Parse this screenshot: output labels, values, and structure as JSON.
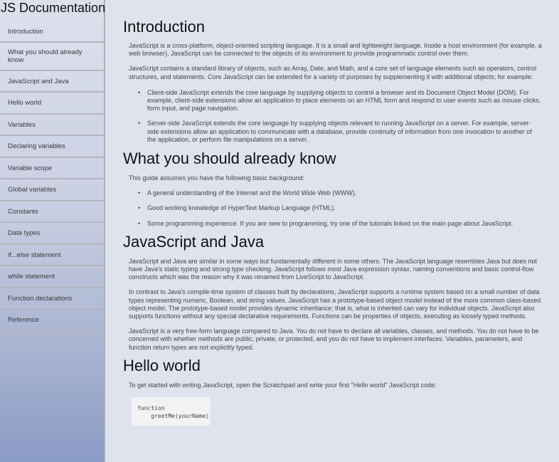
{
  "navbar": {
    "title": "JS Documentation",
    "items": [
      {
        "label": "Introduction"
      },
      {
        "label": "What you should already know"
      },
      {
        "label": "JavaScript and Java"
      },
      {
        "label": "Hello world"
      },
      {
        "label": "Variables"
      },
      {
        "label": "Declaring variables"
      },
      {
        "label": "Variable scope"
      },
      {
        "label": "Global variables"
      },
      {
        "label": "Constants"
      },
      {
        "label": "Data types"
      },
      {
        "label": "if...else statement"
      },
      {
        "label": "while statement"
      },
      {
        "label": "Function declarations"
      },
      {
        "label": "Reference"
      }
    ]
  },
  "sections": {
    "introduction": {
      "title": "Introduction",
      "p1": "JavaScript is a cross-platform, object-oriented scripting language. It is a small and lightweight language. Inside a host environment (for example, a web browser), JavaScript can be connected to the objects of its environment to provide programmatic control over them.",
      "p2": "JavaScript contains a standard library of objects, such as Array, Date, and Math, and a core set of language elements such as operators, control structures, and statements. Core JavaScript can be extended for a variety of purposes by supplementing it with additional objects; for example:",
      "li1": "Client-side JavaScript extends the core language by supplying objects to control a browser and its Document Object Model (DOM). For example, client-side extensions allow an application to place elements on an HTML form and respond to user events such as mouse clicks, form input, and page navigation.",
      "li2": "Server-side JavaScript extends the core language by supplying objects relevant to running JavaScript on a server. For example, server-side extensions allow an application to communicate with a database, provide continuity of information from one invocation to another of the application, or perform file manipulations on a server."
    },
    "what_you_should_know": {
      "title": "What you should already know",
      "p1": "This guide assumes you have the following basic background:",
      "li1": "A general understanding of the Internet and the World Wide Web (WWW).",
      "li2": "Good working knowledge of HyperText Markup Language (HTML).",
      "li3": "Some programming experience. If you are new to programming, try one of the tutorials linked on the main page about JavaScript."
    },
    "javascript_and_java": {
      "title": "JavaScript and Java",
      "p1": "JavaScript and Java are similar in some ways but fundamentally different in some others. The JavaScript language resembles Java but does not have Java's static typing and strong type checking. JavaScript follows most Java expression syntax, naming conventions and basic control-flow constructs which was the reason why it was renamed from LiveScript to JavaScript.",
      "p2": "In contrast to Java's compile-time system of classes built by declarations, JavaScript supports a runtime system based on a small number of data types representing numeric, Boolean, and string values. JavaScript has a prototype-based object model instead of the more common class-based object model. The prototype-based model provides dynamic inheritance; that is, what is inherited can vary for individual objects. JavaScript also supports functions without any special declarative requirements. Functions can be properties of objects, executing as loosely typed methods.",
      "p3": "JavaScript is a very free-form language compared to Java. You do not have to declare all variables, classes, and methods. You do not have to be concerned with whether methods are public, private, or protected, and you do not have to implement interfaces. Variables, parameters, and function return types are not explicitly typed."
    },
    "hello_world": {
      "title": "Hello world",
      "p1": "To get started with writing JavaScript, open the Scratchpad and write your first \"Hello world\" JavaScript code:",
      "code_line1": "function",
      "code_line2": "    greetMe(yourName) {"
    }
  },
  "bullet_char": "•"
}
